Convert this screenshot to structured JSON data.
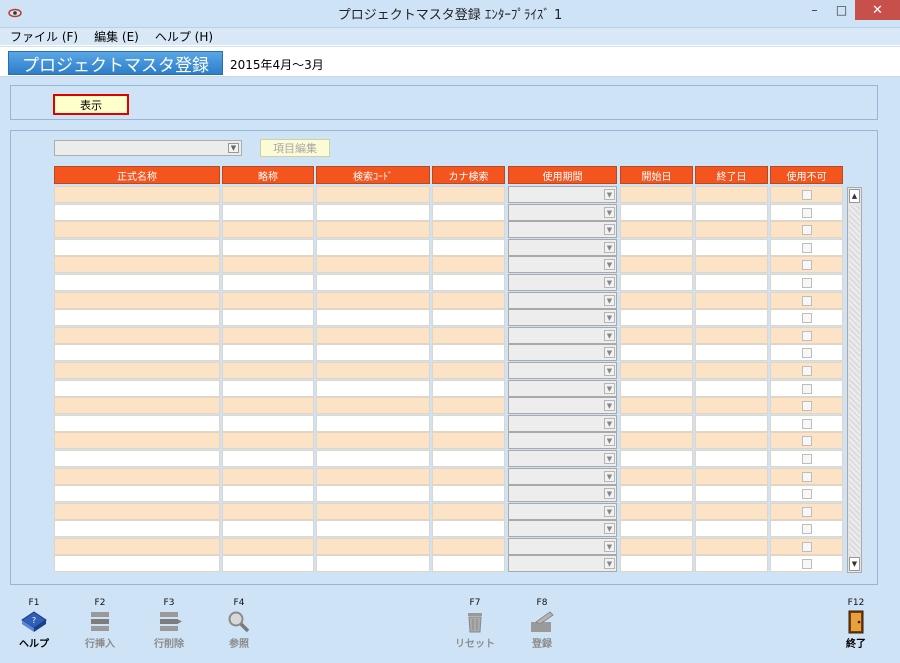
{
  "window": {
    "title": "プロジェクトマスタ登録 ｴﾝﾀｰﾌﾟﾗｲｽﾞ 1",
    "minimize": "–",
    "maximize": "□",
    "close": "✕"
  },
  "menu": [
    {
      "label": "ファイル (F)"
    },
    {
      "label": "編集 (E)"
    },
    {
      "label": "ヘルプ (H)"
    }
  ],
  "header": {
    "screen_title": "プロジェクトマスタ登録",
    "period": "2015年4月～3月"
  },
  "toolbar": {
    "show_label": "表示",
    "edit_items_label": "項目編集",
    "combo_value": ""
  },
  "columns": [
    {
      "label": "正式名称"
    },
    {
      "label": "略称"
    },
    {
      "label": "検索ｺｰﾄﾞ"
    },
    {
      "label": "カナ検索"
    },
    {
      "label": "使用期間"
    },
    {
      "label": "開始日"
    },
    {
      "label": "終了日"
    },
    {
      "label": "使用不可"
    }
  ],
  "grid": {
    "row_count": 22
  },
  "fkeys": [
    {
      "key": "F1",
      "label": "ヘルプ",
      "icon": "help-book-icon",
      "enabled": true
    },
    {
      "key": "F2",
      "label": "行挿入",
      "icon": "insert-row-icon",
      "enabled": false
    },
    {
      "key": "F3",
      "label": "行削除",
      "icon": "delete-row-icon",
      "enabled": false
    },
    {
      "key": "F4",
      "label": "参照",
      "icon": "magnifier-icon",
      "enabled": false
    },
    {
      "key": "F7",
      "label": "リセット",
      "icon": "trash-icon",
      "enabled": false
    },
    {
      "key": "F8",
      "label": "登録",
      "icon": "register-icon",
      "enabled": false
    },
    {
      "key": "F12",
      "label": "終了",
      "icon": "exit-door-icon",
      "enabled": true
    }
  ],
  "colors": {
    "header_orange": "#f4541d",
    "row_peach": "#fce3c6",
    "title_blue": "#2d7ec9",
    "background": "#cfe3f7"
  }
}
